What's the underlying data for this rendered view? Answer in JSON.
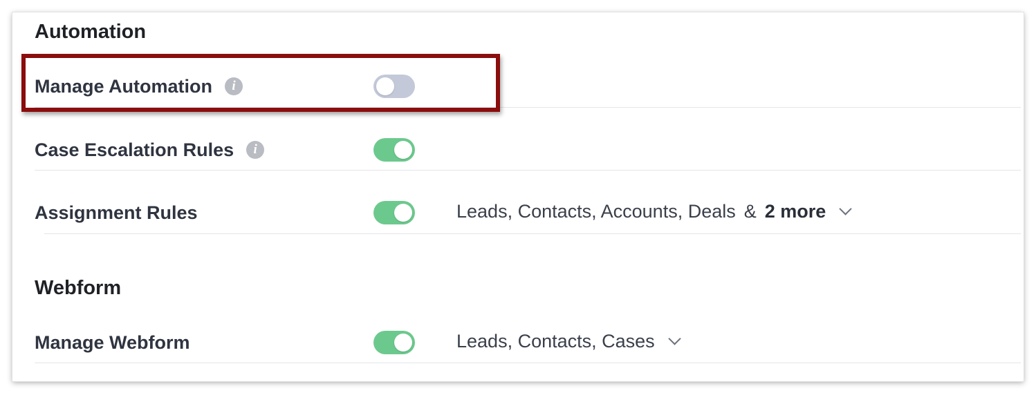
{
  "automation": {
    "title": "Automation",
    "rows": [
      {
        "label": "Manage Automation",
        "has_info": true,
        "enabled": false
      },
      {
        "label": "Case Escalation Rules",
        "has_info": true,
        "enabled": true
      },
      {
        "label": "Assignment Rules",
        "has_info": false,
        "enabled": true,
        "modules": "Leads, Contacts, Accounts, Deals",
        "amp": "&",
        "more": "2 more"
      }
    ]
  },
  "webform": {
    "title": "Webform",
    "rows": [
      {
        "label": "Manage Webform",
        "enabled": true,
        "modules": "Leads, Contacts, Cases"
      }
    ]
  },
  "info_icon_glyph": "i",
  "colors": {
    "toggle_on": "#6cc98d",
    "toggle_off": "#c3c9d9",
    "highlight": "#8b0d0d"
  }
}
